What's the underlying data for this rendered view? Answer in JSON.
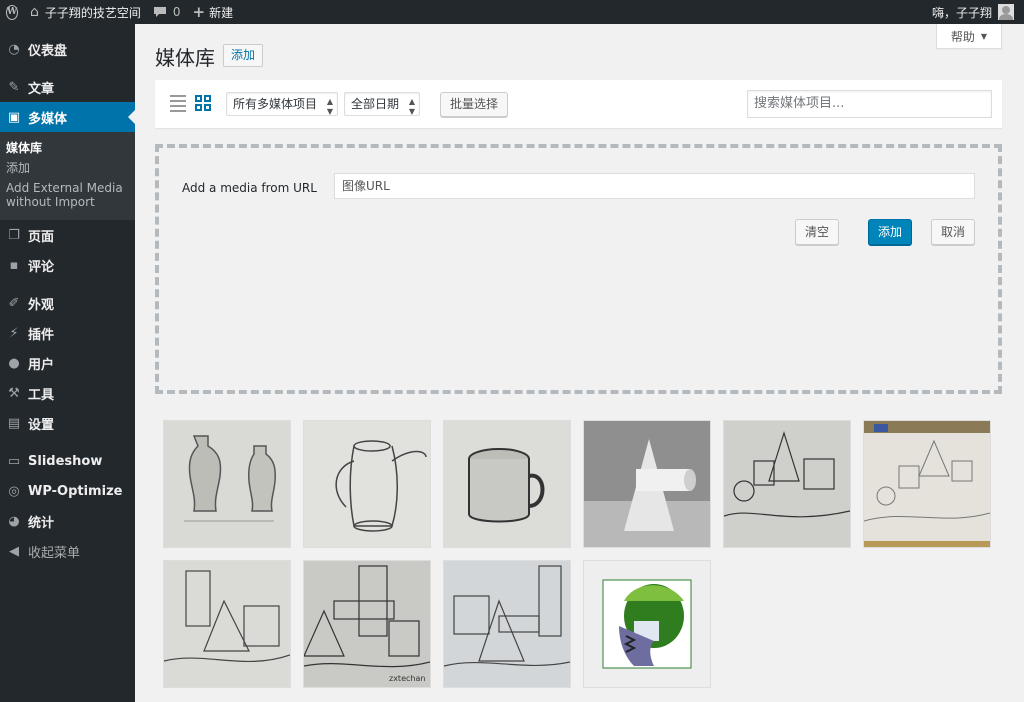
{
  "admin_bar": {
    "site_name": "子子翔的技艺空间",
    "comments_count": "0",
    "new_label": "新建",
    "greeting": "嗨，子子翔"
  },
  "sidebar": {
    "items": [
      {
        "label": "仪表盘",
        "icon": "dashboard-icon"
      },
      {
        "label": "文章",
        "icon": "pin-icon"
      },
      {
        "label": "多媒体",
        "icon": "media-icon",
        "current": true
      },
      {
        "label": "页面",
        "icon": "page-icon"
      },
      {
        "label": "评论",
        "icon": "comment-icon"
      },
      {
        "label": "外观",
        "icon": "brush-icon"
      },
      {
        "label": "插件",
        "icon": "plugin-icon"
      },
      {
        "label": "用户",
        "icon": "user-icon"
      },
      {
        "label": "工具",
        "icon": "wrench-icon"
      },
      {
        "label": "设置",
        "icon": "settings-icon"
      },
      {
        "label": "Slideshow",
        "icon": "slideshow-icon"
      },
      {
        "label": "WP-Optimize",
        "icon": "optimize-icon"
      },
      {
        "label": "统计",
        "icon": "pie-chart-icon"
      },
      {
        "label": "收起菜单",
        "icon": "collapse-icon"
      }
    ],
    "submenu": [
      "媒体库",
      "添加",
      "Add External Media without Import"
    ]
  },
  "main": {
    "help_label": "帮助",
    "title": "媒体库",
    "add_new_label": "添加",
    "filter_type": "所有多媒体项目",
    "filter_date": "全部日期",
    "bulk_select_label": "批量选择",
    "search_placeholder": "搜索媒体项目...",
    "url_label": "Add a media from URL",
    "url_placeholder": "图像URL",
    "clear_label": "清空",
    "add_label": "添加",
    "cancel_label": "取消"
  },
  "media_items": [
    {
      "name": "vase-sketch"
    },
    {
      "name": "teapot-sketch"
    },
    {
      "name": "mug-sketch"
    },
    {
      "name": "cone-cylinder-render"
    },
    {
      "name": "geometric-still-life-sketch"
    },
    {
      "name": "geometric-drawings-photo"
    },
    {
      "name": "cylinder-cone-prism-sketch"
    },
    {
      "name": "cylinder-prism-cone-sketch"
    },
    {
      "name": "cube-cone-cylinder-sketch"
    },
    {
      "name": "head-scan-thumbnail"
    }
  ],
  "colors": {
    "admin_bg": "#23282d",
    "accent": "#0073aa",
    "primary_button": "#0085ba"
  }
}
